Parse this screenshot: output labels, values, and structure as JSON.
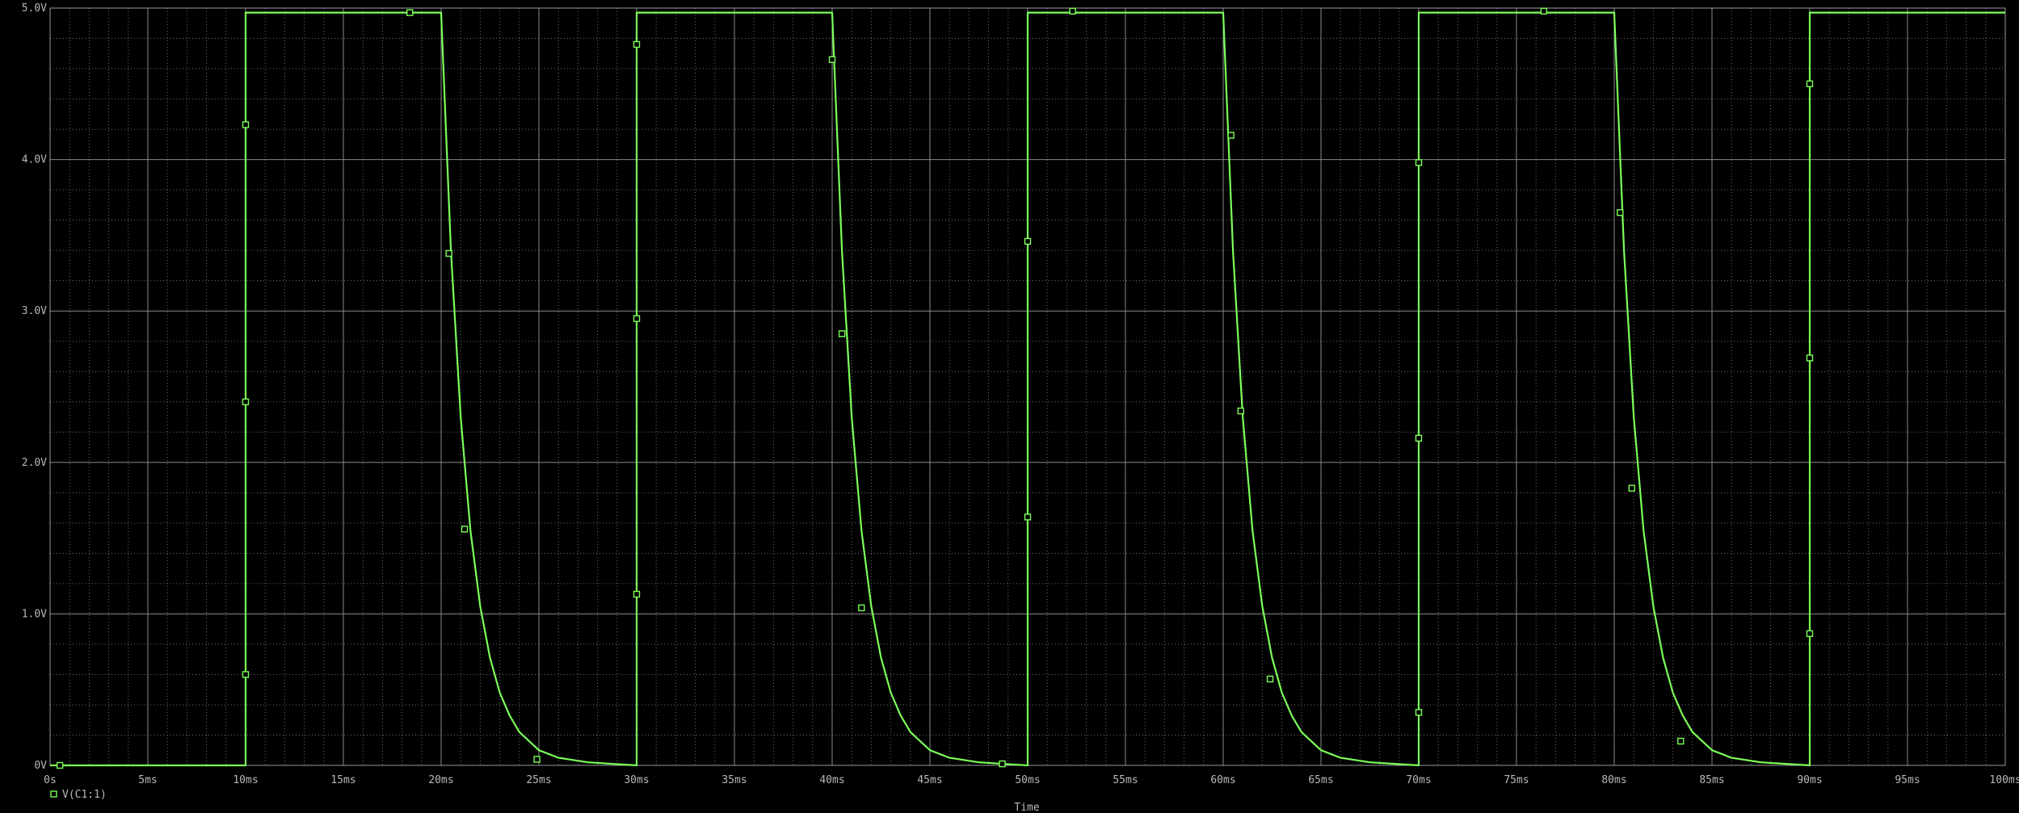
{
  "chart_data": {
    "type": "line",
    "title": "",
    "xlabel": "Time",
    "ylabel": "",
    "xlim": [
      0,
      100
    ],
    "ylim": [
      0,
      5
    ],
    "x_unit": "ms",
    "grid": true,
    "minor_grid": true,
    "background": "#000000",
    "x_ticks": [
      0,
      5,
      10,
      15,
      20,
      25,
      30,
      35,
      40,
      45,
      50,
      55,
      60,
      65,
      70,
      75,
      80,
      85,
      90,
      95,
      100
    ],
    "x_tick_labels": [
      "0s",
      "5ms",
      "10ms",
      "15ms",
      "20ms",
      "25ms",
      "30ms",
      "35ms",
      "40ms",
      "45ms",
      "50ms",
      "55ms",
      "60ms",
      "65ms",
      "70ms",
      "75ms",
      "80ms",
      "85ms",
      "90ms",
      "95ms",
      "100ms"
    ],
    "y_ticks": [
      0,
      1,
      2,
      3,
      4,
      5
    ],
    "y_tick_labels": [
      "0V",
      "1.0V",
      "2.0V",
      "3.0V",
      "4.0V",
      "5.0V"
    ],
    "legend": {
      "placement": "bottom-left"
    },
    "series": [
      {
        "name": "V(C1:1)",
        "color": "#7cff5a",
        "points": [
          [
            0,
            0
          ],
          [
            10,
            0
          ],
          [
            10,
            4.97
          ],
          [
            20,
            4.97
          ],
          [
            20.5,
            3.4
          ],
          [
            21,
            2.3
          ],
          [
            21.5,
            1.55
          ],
          [
            22,
            1.05
          ],
          [
            22.5,
            0.71
          ],
          [
            23,
            0.48
          ],
          [
            23.5,
            0.33
          ],
          [
            24,
            0.22
          ],
          [
            25,
            0.1
          ],
          [
            26,
            0.05
          ],
          [
            27.5,
            0.02
          ],
          [
            30,
            0
          ],
          [
            30,
            4.97
          ],
          [
            40,
            4.97
          ],
          [
            40.5,
            3.4
          ],
          [
            41,
            2.3
          ],
          [
            41.5,
            1.55
          ],
          [
            42,
            1.05
          ],
          [
            42.5,
            0.71
          ],
          [
            43,
            0.48
          ],
          [
            43.5,
            0.33
          ],
          [
            44,
            0.22
          ],
          [
            45,
            0.1
          ],
          [
            46,
            0.05
          ],
          [
            47.5,
            0.02
          ],
          [
            50,
            0
          ],
          [
            50,
            4.97
          ],
          [
            60,
            4.97
          ],
          [
            60.5,
            3.4
          ],
          [
            61,
            2.3
          ],
          [
            61.5,
            1.55
          ],
          [
            62,
            1.05
          ],
          [
            62.5,
            0.71
          ],
          [
            63,
            0.48
          ],
          [
            63.5,
            0.33
          ],
          [
            64,
            0.22
          ],
          [
            65,
            0.1
          ],
          [
            66,
            0.05
          ],
          [
            67.5,
            0.02
          ],
          [
            70,
            0
          ],
          [
            70,
            4.97
          ],
          [
            80,
            4.97
          ],
          [
            80.5,
            3.4
          ],
          [
            81,
            2.3
          ],
          [
            81.5,
            1.55
          ],
          [
            82,
            1.05
          ],
          [
            82.5,
            0.71
          ],
          [
            83,
            0.48
          ],
          [
            83.5,
            0.33
          ],
          [
            84,
            0.22
          ],
          [
            85,
            0.1
          ],
          [
            86,
            0.05
          ],
          [
            87.5,
            0.02
          ],
          [
            90,
            0
          ],
          [
            90,
            4.97
          ],
          [
            100,
            4.97
          ]
        ],
        "markers": [
          [
            0.5,
            0
          ],
          [
            10,
            0.6
          ],
          [
            10,
            2.4
          ],
          [
            10,
            4.23
          ],
          [
            18.4,
            4.97
          ],
          [
            20.4,
            3.38
          ],
          [
            21.2,
            1.56
          ],
          [
            24.9,
            0.04
          ],
          [
            30,
            1.13
          ],
          [
            30,
            2.95
          ],
          [
            30,
            4.76
          ],
          [
            40,
            4.66
          ],
          [
            40.5,
            2.85
          ],
          [
            41.5,
            1.04
          ],
          [
            48.7,
            0.01
          ],
          [
            50,
            1.64
          ],
          [
            50,
            3.46
          ],
          [
            52.3,
            4.98
          ],
          [
            60.4,
            4.16
          ],
          [
            60.9,
            2.34
          ],
          [
            62.4,
            0.57
          ],
          [
            70,
            0.35
          ],
          [
            70,
            2.16
          ],
          [
            70,
            3.98
          ],
          [
            76.4,
            4.98
          ],
          [
            80.3,
            3.65
          ],
          [
            80.9,
            1.83
          ],
          [
            83.4,
            0.16
          ],
          [
            90,
            0.87
          ],
          [
            90,
            2.69
          ],
          [
            90,
            4.5
          ]
        ]
      }
    ]
  }
}
